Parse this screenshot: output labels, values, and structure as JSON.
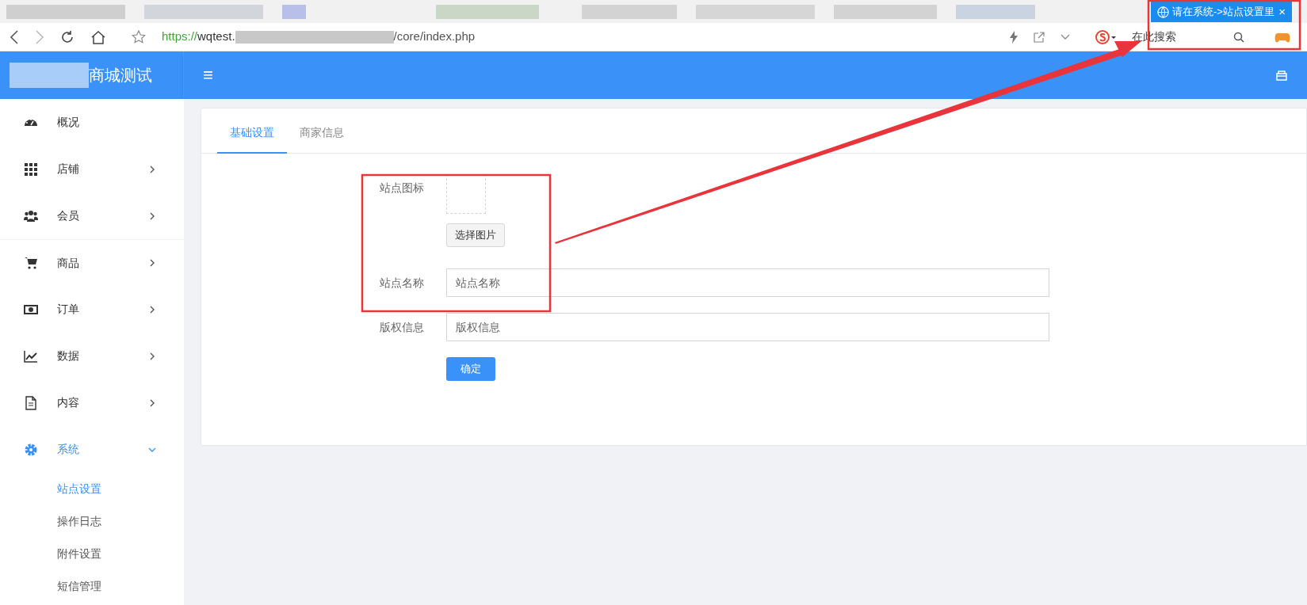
{
  "browser": {
    "active_tab": {
      "title": "请在系统->站点设置里",
      "close": "×"
    },
    "address": {
      "scheme": "https://",
      "host": "wqtest.",
      "path": "/core/index.php"
    },
    "search": {
      "placeholder": "在此搜索"
    }
  },
  "header": {
    "brand": "商城测试",
    "menu_icon": "≡"
  },
  "sidebar": {
    "items": [
      {
        "label": "概况",
        "selected": false
      },
      {
        "label": "店铺",
        "expanded": false,
        "selected": false
      },
      {
        "label": "会员",
        "expanded": false,
        "selected": false
      },
      {
        "label": "商品",
        "expanded": false,
        "selected": false
      },
      {
        "label": "订单",
        "expanded": false,
        "selected": false
      },
      {
        "label": "数据",
        "expanded": false,
        "selected": false
      },
      {
        "label": "内容",
        "expanded": false,
        "selected": false
      },
      {
        "label": "系统",
        "expanded": true,
        "selected": true,
        "children": [
          {
            "label": "站点设置",
            "selected": true
          },
          {
            "label": "操作日志",
            "selected": false
          },
          {
            "label": "附件设置",
            "selected": false
          },
          {
            "label": "短信管理",
            "selected": false
          }
        ]
      }
    ]
  },
  "tabs": [
    {
      "label": "基础设置",
      "selected": true
    },
    {
      "label": "商家信息",
      "selected": false
    }
  ],
  "form": {
    "fields": [
      {
        "kind": "image",
        "label": "站点图标",
        "button": "选择图片"
      },
      {
        "kind": "text",
        "label": "站点名称",
        "placeholder": "站点名称"
      },
      {
        "kind": "text",
        "label": "版权信息",
        "placeholder": "版权信息"
      }
    ],
    "submit": "确定"
  }
}
